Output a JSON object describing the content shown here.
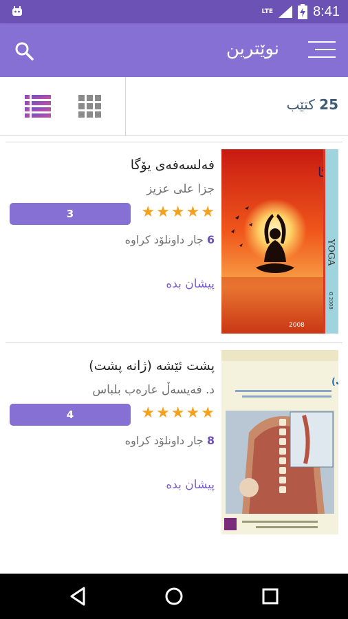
{
  "status_bar": {
    "network": "LTE",
    "time": "8:41"
  },
  "toolbar": {
    "title": "نوێترین"
  },
  "filter": {
    "count": "25",
    "count_label": "کتێب"
  },
  "books": [
    {
      "title": "فەلسەفەی یۆگا",
      "author": "جزا علی عزیز",
      "rating": "3",
      "stars": 5,
      "downloads_count": "6",
      "downloads_label": "جار داونلۆد کراوە",
      "preview": "پیشان بدە",
      "cover_title": "فەلسەفەی یۆگا",
      "cover_spine": "YOGA",
      "cover_spine_bottom": "G 2008",
      "cover_year": "2008"
    },
    {
      "title": "پشت ئێشە (ژانە پشت)",
      "author": "د. فەیسەڵ عارەب بلباس",
      "rating": "4",
      "stars": 5,
      "downloads_count": "8",
      "downloads_label": "جار داونلۆد کراوە",
      "preview": "پیشان بدە",
      "cover_title": "پشت ئێشە (ژانە پشت)"
    }
  ],
  "colors": {
    "primary": "#8670d4",
    "primary_dark": "#6d52b5",
    "star": "#f4a11d",
    "count_text": "#3f5a77"
  }
}
